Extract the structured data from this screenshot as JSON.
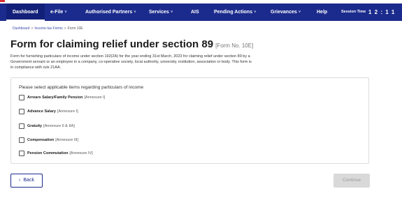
{
  "nav": {
    "items": [
      {
        "label": "Dashboard",
        "active": true,
        "has_dropdown": false
      },
      {
        "label": "e-File",
        "active": false,
        "has_dropdown": true
      },
      {
        "label": "Authorised Partners",
        "active": false,
        "has_dropdown": true
      },
      {
        "label": "Services",
        "active": false,
        "has_dropdown": true
      },
      {
        "label": "AIS",
        "active": false,
        "has_dropdown": false
      },
      {
        "label": "Pending Actions",
        "active": false,
        "has_dropdown": true
      },
      {
        "label": "Grievances",
        "active": false,
        "has_dropdown": true
      },
      {
        "label": "Help",
        "active": false,
        "has_dropdown": false
      }
    ],
    "session_label": "Session Time",
    "session_time": "1 2 : 1 1",
    "dropdown_icon": "chevron-down-icon"
  },
  "breadcrumb": {
    "items": [
      "Dashboard",
      "Income-tax Forms",
      "Form 10E"
    ],
    "separator": ">"
  },
  "page": {
    "title": "Form for claiming relief under section 89",
    "form_no": "[Form No. 10E]",
    "description": "Form for furnishing particulars of income under section 192(2A) for the year ending 31st March, 2023 for claiming relief under section 89 by a Government servant or an employee in a company, co-operative society, local authority, university, institution, association or body. This form is in compliance with rule 21AA."
  },
  "selection": {
    "heading": "Please select applicable items regarding particulars of income",
    "options": [
      {
        "label": "Arrears Salary/Family Pension",
        "annexure": "[Annexure I]",
        "checked": false
      },
      {
        "label": "Advance Salary",
        "annexure": "[Annexure I]",
        "checked": false
      },
      {
        "label": "Gratuity",
        "annexure": "[Annexure II & IIA]",
        "checked": false
      },
      {
        "label": "Compensation",
        "annexure": "[Annexure III]",
        "checked": false
      },
      {
        "label": "Pension Commutation",
        "annexure": "[Annexure IV]",
        "checked": false
      }
    ]
  },
  "actions": {
    "back_label": "Back",
    "continue_label": "Continue",
    "continue_enabled": false
  },
  "colors": {
    "nav_bg": "#1b2b8d",
    "accent_red": "#d62f2f",
    "disabled_bg": "#d9d9d9"
  }
}
